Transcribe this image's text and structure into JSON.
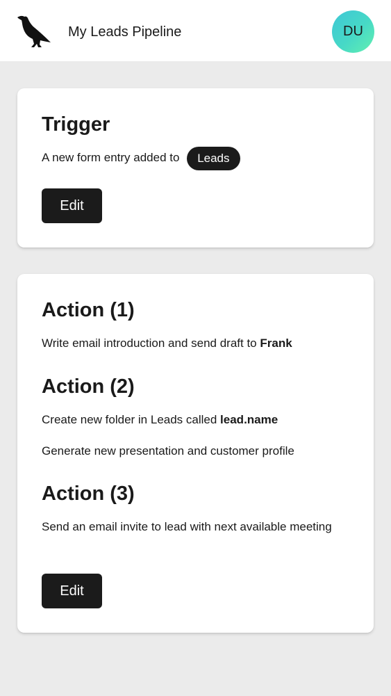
{
  "header": {
    "logo_icon": "crow-icon",
    "title": "My Leads Pipeline",
    "avatar_initials": "DU"
  },
  "trigger": {
    "heading": "Trigger",
    "description": "A new form entry added to",
    "tag": "Leads",
    "edit_label": "Edit"
  },
  "actions": {
    "items": [
      {
        "heading": "Action (1)",
        "lines": [
          {
            "text": "Write email introduction and send draft to ",
            "bold": "Frank"
          }
        ]
      },
      {
        "heading": "Action (2)",
        "lines": [
          {
            "text": "Create new folder in Leads called ",
            "bold": "lead.name"
          },
          {
            "text": "Generate new presentation and customer profile",
            "bold": ""
          }
        ]
      },
      {
        "heading": "Action (3)",
        "lines": [
          {
            "text": "Send an email invite to lead with next available meeting",
            "bold": ""
          }
        ]
      }
    ],
    "edit_label": "Edit"
  },
  "colors": {
    "background": "#ebebeb",
    "card": "#ffffff",
    "button": "#1b1b1b",
    "avatar_gradient_start": "#3ec7d6",
    "avatar_gradient_end": "#63f0b0"
  }
}
